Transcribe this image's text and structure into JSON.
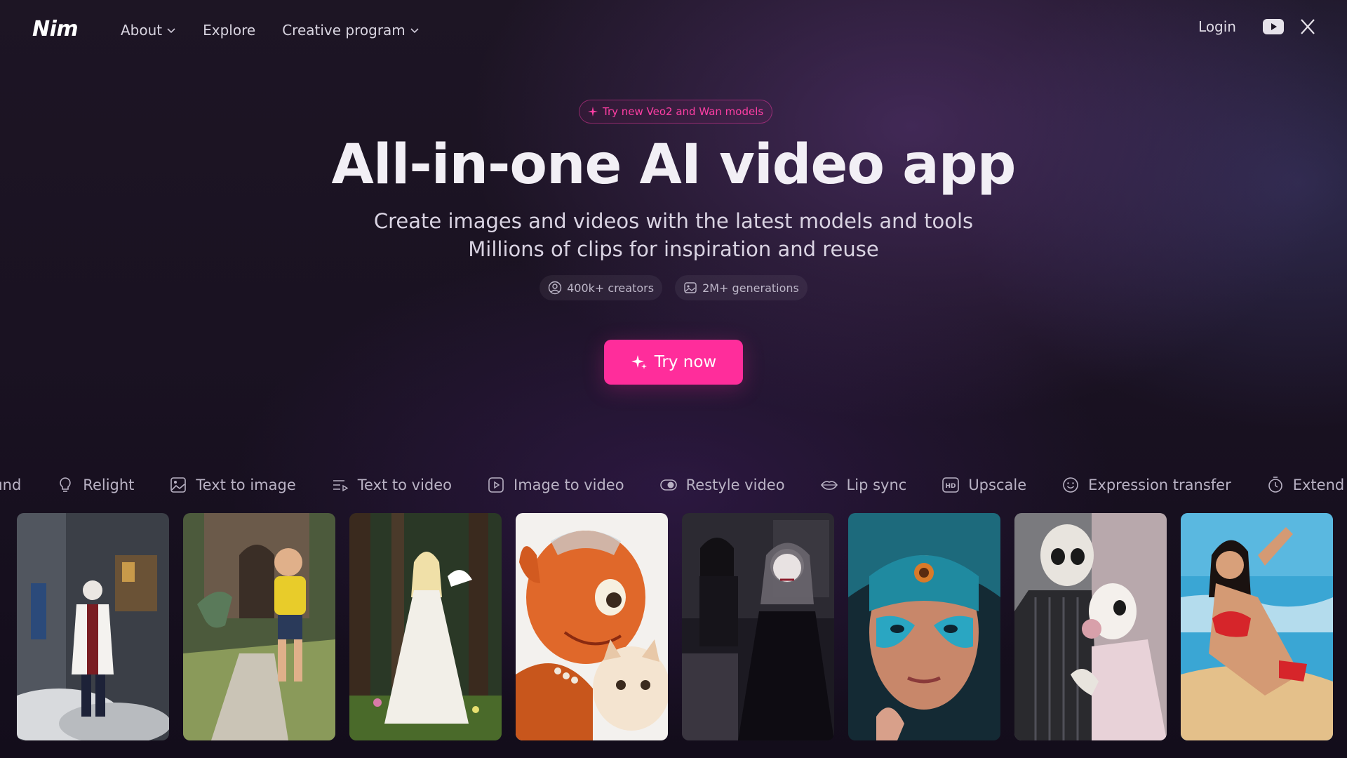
{
  "brand": {
    "logo": "Nim"
  },
  "nav": {
    "items": [
      {
        "label": "About",
        "has_dropdown": true
      },
      {
        "label": "Explore",
        "has_dropdown": false
      },
      {
        "label": "Creative program",
        "has_dropdown": true
      }
    ],
    "login": "Login",
    "social": [
      "youtube-icon",
      "x-icon"
    ]
  },
  "hero": {
    "badge": "Try new Veo2 and Wan models",
    "title": "All-in-one AI video app",
    "subtitle_line1": "Create images and videos with the latest models and tools",
    "subtitle_line2": "Millions of clips for inspiration and reuse",
    "stats": [
      {
        "label": "400k+ creators",
        "icon": "user-circle-icon"
      },
      {
        "label": "2M+ generations",
        "icon": "image-icon"
      }
    ],
    "cta": "Try now"
  },
  "tools": [
    {
      "label": "Background",
      "icon": "background-icon"
    },
    {
      "label": "Relight",
      "icon": "lightbulb-icon"
    },
    {
      "label": "Text to image",
      "icon": "image-icon"
    },
    {
      "label": "Text to video",
      "icon": "text-lines-icon"
    },
    {
      "label": "Image to video",
      "icon": "play-square-icon"
    },
    {
      "label": "Restyle video",
      "icon": "toggle-icon"
    },
    {
      "label": "Lip sync",
      "icon": "lips-icon"
    },
    {
      "label": "Upscale",
      "icon": "hd-icon"
    },
    {
      "label": "Expression transfer",
      "icon": "smile-icon"
    },
    {
      "label": "Extend",
      "icon": "timer-icon"
    }
  ],
  "gallery": [
    {
      "subject": "joker-in-lab-coat",
      "palette": [
        "#3a3f48",
        "#9aa2ab",
        "#e8e9ec"
      ]
    },
    {
      "subject": "boy-running-with-dinosaur",
      "palette": [
        "#4a5a3a",
        "#d9c23a",
        "#c8c2b5"
      ]
    },
    {
      "subject": "woman-in-white-dress-forest",
      "palette": [
        "#2a3a24",
        "#6a7a4a",
        "#e8e4dc"
      ]
    },
    {
      "subject": "orange-alien-with-kitten",
      "palette": [
        "#f3f1ee",
        "#e06a22",
        "#c85a1c"
      ]
    },
    {
      "subject": "gothic-vampire-women",
      "palette": [
        "#1c1a22",
        "#3a3642",
        "#d8d4d8"
      ]
    },
    {
      "subject": "blue-painted-face",
      "palette": [
        "#1a6a78",
        "#2aa6c2",
        "#c88a6a"
      ]
    },
    {
      "subject": "skeleton-couple",
      "palette": [
        "#6a6a6e",
        "#e8e4e4",
        "#d8a8b4"
      ]
    },
    {
      "subject": "woman-in-red-bikini-beach",
      "palette": [
        "#4ab0d8",
        "#e8c89a",
        "#d8252a"
      ]
    }
  ],
  "colors": {
    "accent": "#ff2d9b",
    "badge_text": "#ff3fa4",
    "background": "#1a1222"
  }
}
